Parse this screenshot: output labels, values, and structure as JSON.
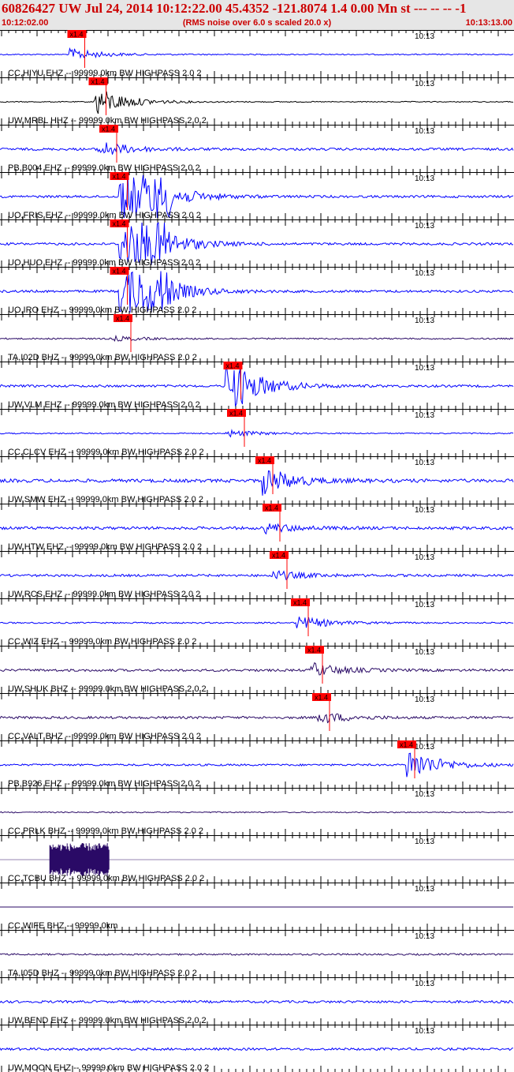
{
  "header": {
    "title": "60826427 UW Jul 24, 2014 10:12:22.00   45.4352 -121.8074  1.4 0.00 Mn st --- -- --  -1",
    "start_time": "10:12:02.00",
    "note": "(RMS noise over 6.0 s scaled 20.0 x)",
    "end_time": "10:13:13.00"
  },
  "colors": {
    "blue": "#0000ff",
    "navy": "#2a0a66",
    "black": "#000000",
    "red": "#ff0000",
    "header_text": "#cc0000",
    "header_bg": "#e6e6e6"
  },
  "pick_label": "x1.4",
  "chart_data": {
    "type": "line",
    "x_start": "10:12:02.00",
    "x_end": "10:13:13.00",
    "minute_mark": "10:13",
    "traces": [
      {
        "label": "CC,HIYU EHZ -- 99999.0km BW  HIGHPASS  2.0  2",
        "color": "blue",
        "pick_time_s": 9.5,
        "burst_time_s": 10,
        "burst_amp": 0.5,
        "noise": 0.12
      },
      {
        "label": "UW,MRBL HHZ -- 99999.0km BW  HIGHPASS  2.0  2",
        "color": "black",
        "pick_time_s": 12.5,
        "burst_time_s": 13.5,
        "burst_amp": 1.3,
        "noise": 0.1
      },
      {
        "label": "PB,B004 EHZ -- 99999.0km BW  HIGHPASS  2.0  2",
        "color": "blue",
        "pick_time_s": 14.0,
        "burst_time_s": 14,
        "burst_amp": 0.7,
        "noise": 0.25
      },
      {
        "label": "UO,FRIS EHZ -- 99999.0km BW  HIGHPASS  2.0  2",
        "color": "blue",
        "pick_time_s": 15.5,
        "burst_time_s": 19,
        "burst_amp": 3.0,
        "noise": 0.25,
        "saturated_s": [
          16.5,
          24
        ]
      },
      {
        "label": "UO,HUO EHZ -- 99999.0km BW  HIGHPASS  2.0  2",
        "color": "blue",
        "pick_time_s": 15.5,
        "burst_time_s": 19,
        "burst_amp": 3.0,
        "noise": 0.25,
        "saturated_s": [
          16.5,
          24
        ]
      },
      {
        "label": "UO,IRO EHZ -- 99999.0km BW  HIGHPASS  2.0  2",
        "color": "blue",
        "pick_time_s": 15.5,
        "burst_time_s": 19,
        "burst_amp": 3.0,
        "noise": 0.25,
        "saturated_s": [
          16.5,
          24
        ]
      },
      {
        "label": "TA,I02D BHZ -- 99999.0km BW  HIGHPASS  2.0  2",
        "color": "navy",
        "pick_time_s": 16.0,
        "burst_time_s": 16,
        "burst_amp": 0.2,
        "noise": 0.15
      },
      {
        "label": "UW,VLM EHZ -- 99999.0km BW  HIGHPASS  2.0  2",
        "color": "blue",
        "pick_time_s": 31.5,
        "burst_time_s": 32,
        "burst_amp": 2.5,
        "noise": 0.25,
        "saturated_s": [
          31.5,
          32.5
        ]
      },
      {
        "label": "CC,CLCV EHZ -- 99999.0km BW  HIGHPASS  2.0  2",
        "color": "blue",
        "pick_time_s": 32.0,
        "burst_time_s": 32,
        "burst_amp": 0.3,
        "noise": 0.12
      },
      {
        "label": "UW,SMW EHZ -- 99999.0km BW  HIGHPASS  2.0  2",
        "color": "blue",
        "pick_time_s": 36.0,
        "burst_time_s": 37,
        "burst_amp": 1.2,
        "noise": 0.35
      },
      {
        "label": "UW,HTW EHZ -- 99999.0km BW  HIGHPASS  2.0  2",
        "color": "blue",
        "pick_time_s": 37.0,
        "burst_time_s": 37.5,
        "burst_amp": 0.4,
        "noise": 0.3
      },
      {
        "label": "UW,RCS EHZ -- 99999.0km BW  HIGHPASS  2.0  2",
        "color": "blue",
        "pick_time_s": 38.0,
        "burst_time_s": 38.5,
        "burst_amp": 0.4,
        "noise": 0.25
      },
      {
        "label": "CC,WIZ EHZ -- 99999.0km BW  HIGHPASS  2.0  2",
        "color": "blue",
        "pick_time_s": 41.0,
        "burst_time_s": 42,
        "burst_amp": 0.6,
        "noise": 0.15
      },
      {
        "label": "UW,SHUK BHZ -- 99999.0km BW  HIGHPASS  2.0  2",
        "color": "navy",
        "pick_time_s": 43.0,
        "burst_time_s": 44,
        "burst_amp": 0.6,
        "noise": 0.25
      },
      {
        "label": "CC,VALT BHZ -- 99999.0km BW  HIGHPASS  2.0  2",
        "color": "navy",
        "pick_time_s": 44.0,
        "burst_time_s": 45,
        "burst_amp": 0.5,
        "noise": 0.25
      },
      {
        "label": "PB,B926 EHZ -- 99999.0km BW  HIGHPASS  2.0  2",
        "color": "blue",
        "pick_time_s": 56.0,
        "burst_time_s": 57.5,
        "burst_amp": 1.4,
        "noise": 0.2
      },
      {
        "label": "CC,PRLK BHZ -- 99999.0km BW  HIGHPASS  2.0  2",
        "color": "navy",
        "pick_time_s": null,
        "burst_time_s": null,
        "burst_amp": 0,
        "noise": 0.12
      },
      {
        "label": "CC,TCBU BHZ -- 99999.0km BW  HIGHPASS  2.0  2",
        "color": "navy",
        "pick_time_s": null,
        "burst_time_s": 8.5,
        "burst_amp": 1.2,
        "noise": 0.0,
        "block_s": [
          6.8,
          15.2
        ]
      },
      {
        "label": "CC,WIFE BHZ -- 99999.0km",
        "color": "navy",
        "pick_time_s": null,
        "burst_time_s": null,
        "burst_amp": 0,
        "noise": 0.0
      },
      {
        "label": "TA,I05D BHZ -- 99999.0km BW  HIGHPASS  2.0  2",
        "color": "navy",
        "pick_time_s": null,
        "burst_time_s": null,
        "burst_amp": 0,
        "noise": 0.18
      },
      {
        "label": "UW,BEND EHZ -- 99999.0km BW  HIGHPASS  2.0  2",
        "color": "blue",
        "pick_time_s": null,
        "burst_time_s": null,
        "burst_amp": 0,
        "noise": 0.25
      },
      {
        "label": "UW,MOON EHZ -- 99999.0km BW  HIGHPASS  2.0  2",
        "color": "blue",
        "pick_time_s": null,
        "burst_time_s": null,
        "burst_amp": 0,
        "noise": 0.25
      }
    ]
  }
}
